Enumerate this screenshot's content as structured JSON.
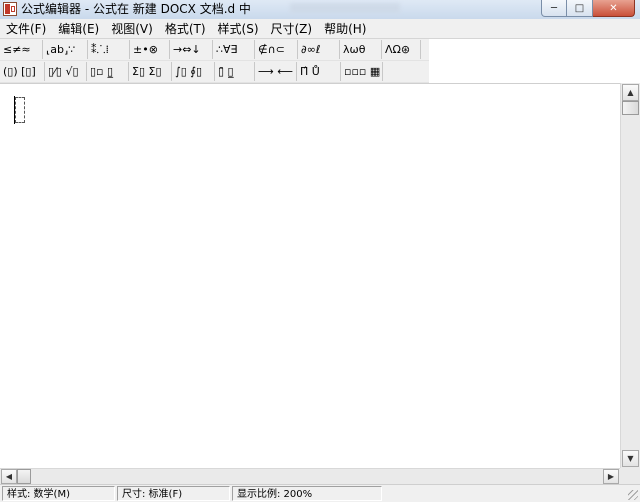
{
  "window": {
    "title": "公式编辑器 - 公式在 新建 DOCX 文档.d 中",
    "buttons": {
      "minimize": "─",
      "maximize": "□",
      "close": "✕"
    }
  },
  "menubar": {
    "items": [
      {
        "label": "文件(F)"
      },
      {
        "label": "编辑(E)"
      },
      {
        "label": "视图(V)"
      },
      {
        "label": "格式(T)"
      },
      {
        "label": "样式(S)"
      },
      {
        "label": "尺寸(Z)"
      },
      {
        "label": "帮助(H)"
      }
    ]
  },
  "toolbar": {
    "row1": [
      {
        "label": "≤≠≈"
      },
      {
        "label": "⸤ab⸥∵"
      },
      {
        "label": "⁑⸫⁞"
      },
      {
        "label": "±•⊗"
      },
      {
        "label": "→⇔↓"
      },
      {
        "label": "∴∀∃"
      },
      {
        "label": "∉∩⊂"
      },
      {
        "label": "∂∞ℓ"
      },
      {
        "label": "λωθ"
      },
      {
        "label": "ΛΩ⊛"
      }
    ],
    "row2": [
      {
        "label": "(▯) [▯]"
      },
      {
        "label": "▯⁄▯ √▯"
      },
      {
        "label": "▯▫ ▯̲"
      },
      {
        "label": "Σ▯ Σ▯"
      },
      {
        "label": "∫▯ ∮▯"
      },
      {
        "label": "▯̄ ▯̲"
      },
      {
        "label": "⟶ ⟵"
      },
      {
        "label": "Π̂ Ů"
      },
      {
        "label": "▫▫▫ ▦"
      }
    ]
  },
  "statusbar": {
    "style": "样式: 数学(M)",
    "size": "尺寸: 标准(F)",
    "zoom": "显示比例: 200%"
  },
  "icons": {
    "app": "formula-editor-icon",
    "scroll_up": "▲",
    "scroll_down": "▼",
    "scroll_left": "◀",
    "scroll_right": "▶"
  },
  "colors": {
    "titlebar": "#dfe9f5",
    "close_button": "#c9503a"
  }
}
